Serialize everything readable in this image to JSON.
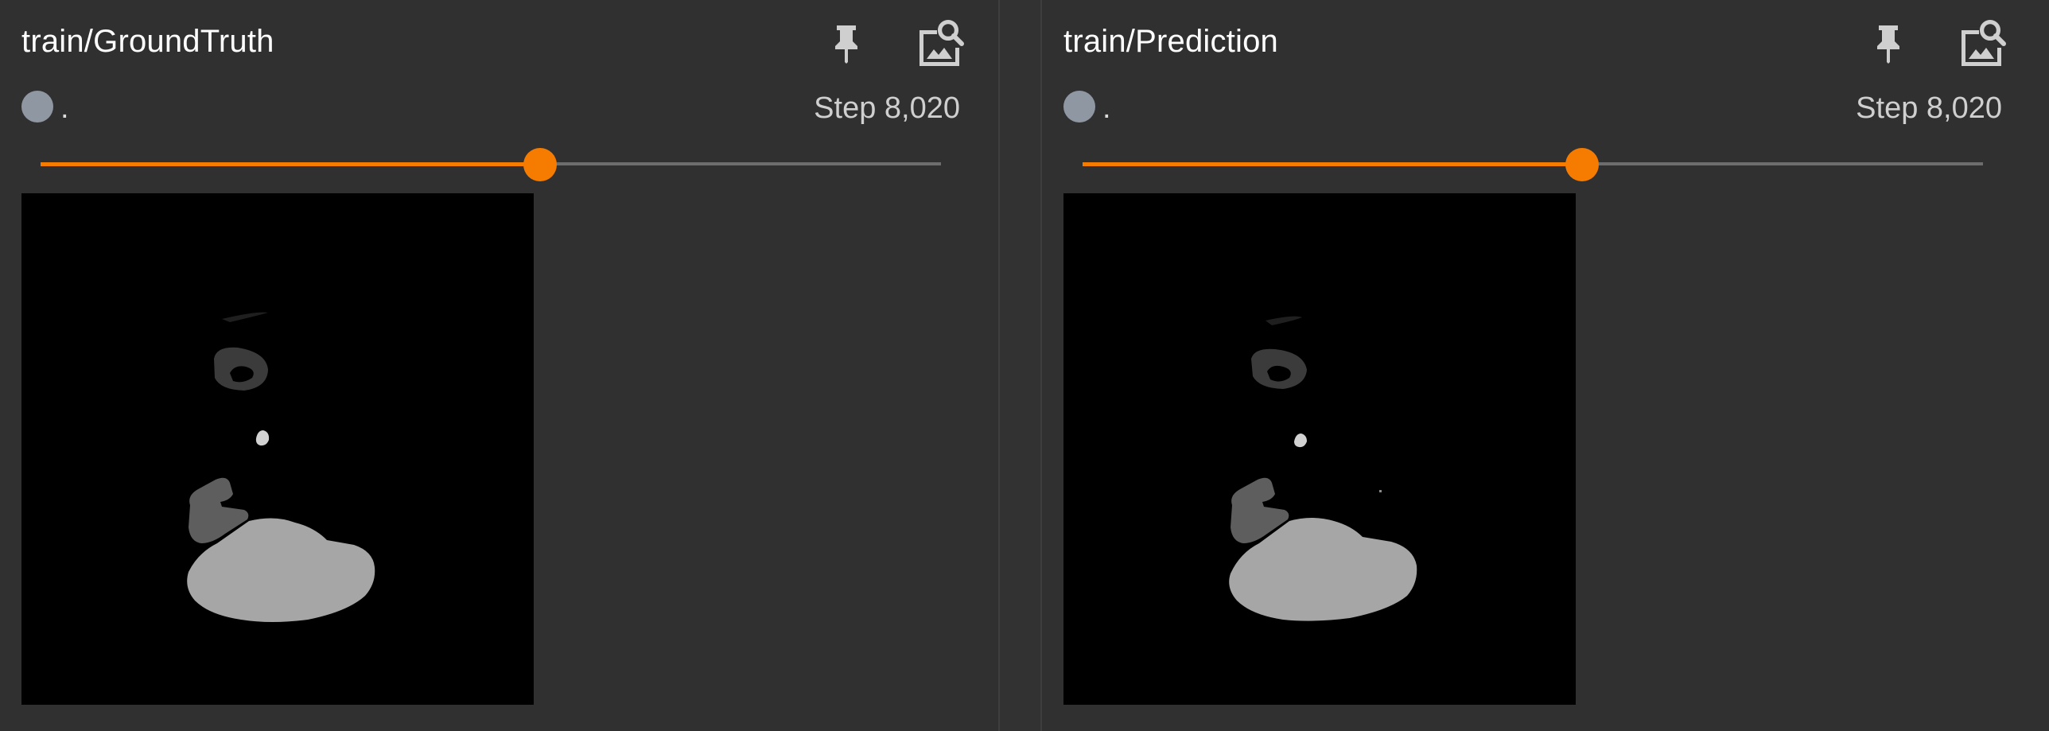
{
  "panels": [
    {
      "title": "train/GroundTruth",
      "run_label": ".",
      "step_label": "Step 8,020",
      "slider_fraction": 0.555,
      "colors": {
        "accent": "#f57c00",
        "run_dot": "#8f97a3"
      },
      "icons": [
        "pin-icon",
        "image-search-icon"
      ]
    },
    {
      "title": "train/Prediction",
      "run_label": ".",
      "step_label": "Step 8,020",
      "slider_fraction": 0.555,
      "colors": {
        "accent": "#f57c00",
        "run_dot": "#8f97a3"
      },
      "icons": [
        "pin-icon",
        "image-search-icon"
      ]
    }
  ]
}
